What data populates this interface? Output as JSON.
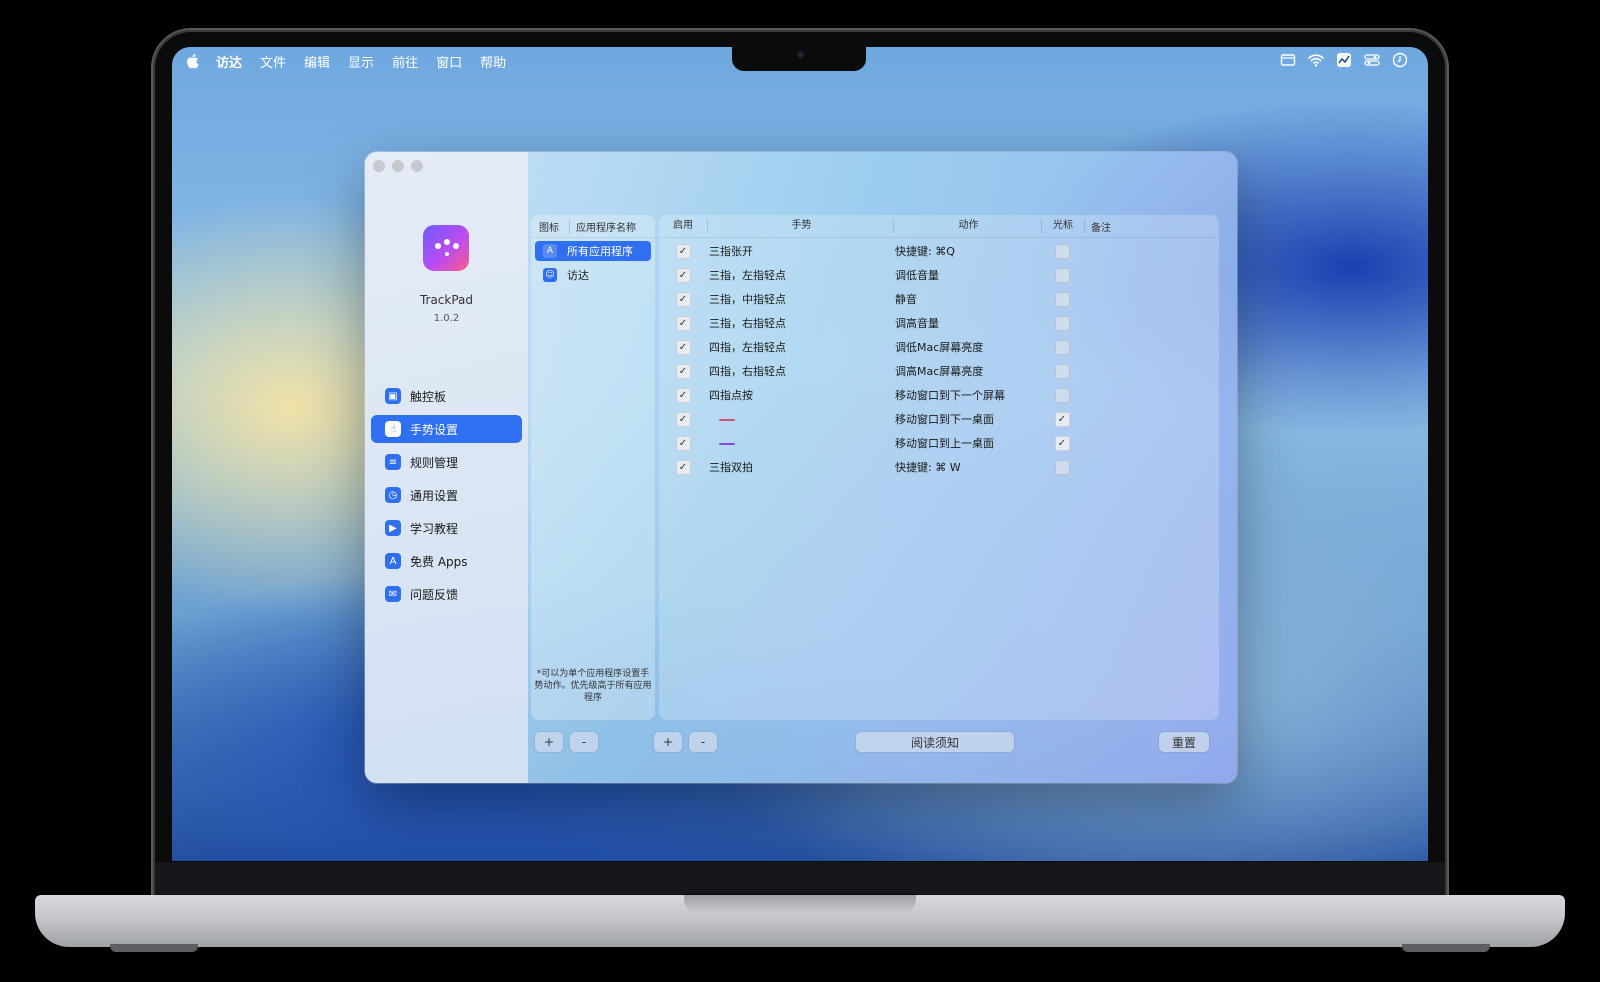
{
  "menubar": {
    "app_name": "访达",
    "items": [
      "文件",
      "编辑",
      "显示",
      "前往",
      "窗口",
      "帮助"
    ]
  },
  "app": {
    "name": "TrackPad",
    "version": "1.0.2"
  },
  "nav": {
    "items": [
      {
        "label": "触控板",
        "icon": "trackpad-icon"
      },
      {
        "label": "手势设置",
        "icon": "gesture-icon",
        "active": true
      },
      {
        "label": "规则管理",
        "icon": "list-icon"
      },
      {
        "label": "通用设置",
        "icon": "clock-icon"
      },
      {
        "label": "学习教程",
        "icon": "tutorial-icon"
      },
      {
        "label": "免费 Apps",
        "icon": "appstore-icon"
      },
      {
        "label": "问题反馈",
        "icon": "feedback-icon"
      }
    ]
  },
  "apps_panel": {
    "col_icon": "图标",
    "col_name": "应用程序名称",
    "rows": [
      {
        "name": "所有应用程序",
        "selected": true
      },
      {
        "name": "访达",
        "selected": false
      }
    ],
    "note": "*可以为单个应用程序设置手势动作。优先级高于所有应用程序"
  },
  "gesture_table": {
    "headers": {
      "enabled": "启用",
      "gesture": "手势",
      "action": "动作",
      "cursor": "光标",
      "note": "备注"
    },
    "rows": [
      {
        "enabled": true,
        "gesture": "三指张开",
        "action": "快捷键: ⌘Q",
        "cursor": false
      },
      {
        "enabled": true,
        "gesture": "三指，左指轻点",
        "action": "调低音量",
        "cursor": false
      },
      {
        "enabled": true,
        "gesture": "三指，中指轻点",
        "action": "静音",
        "cursor": false
      },
      {
        "enabled": true,
        "gesture": "三指，右指轻点",
        "action": "调高音量",
        "cursor": false
      },
      {
        "enabled": true,
        "gesture": "四指，左指轻点",
        "action": "调低Mac屏幕亮度",
        "cursor": false
      },
      {
        "enabled": true,
        "gesture": "四指，右指轻点",
        "action": "调高Mac屏幕亮度",
        "cursor": false
      },
      {
        "enabled": true,
        "gesture": "四指点按",
        "action": "移动窗口到下一个屏幕",
        "cursor": false
      },
      {
        "enabled": true,
        "gesture": "",
        "action": "移动窗口到下一桌面",
        "cursor": true,
        "indicator": "#e04a7a"
      },
      {
        "enabled": true,
        "gesture": "",
        "action": "移动窗口到上一桌面",
        "cursor": true,
        "indicator": "#8a4ae0"
      },
      {
        "enabled": true,
        "gesture": "三指双拍",
        "action": "快捷键: ⌘ W",
        "cursor": false
      }
    ]
  },
  "buttons": {
    "add": "+",
    "remove": "-",
    "read_notice": "阅读须知",
    "reset": "重置"
  },
  "colors": {
    "accent": "#2f6ff0"
  }
}
